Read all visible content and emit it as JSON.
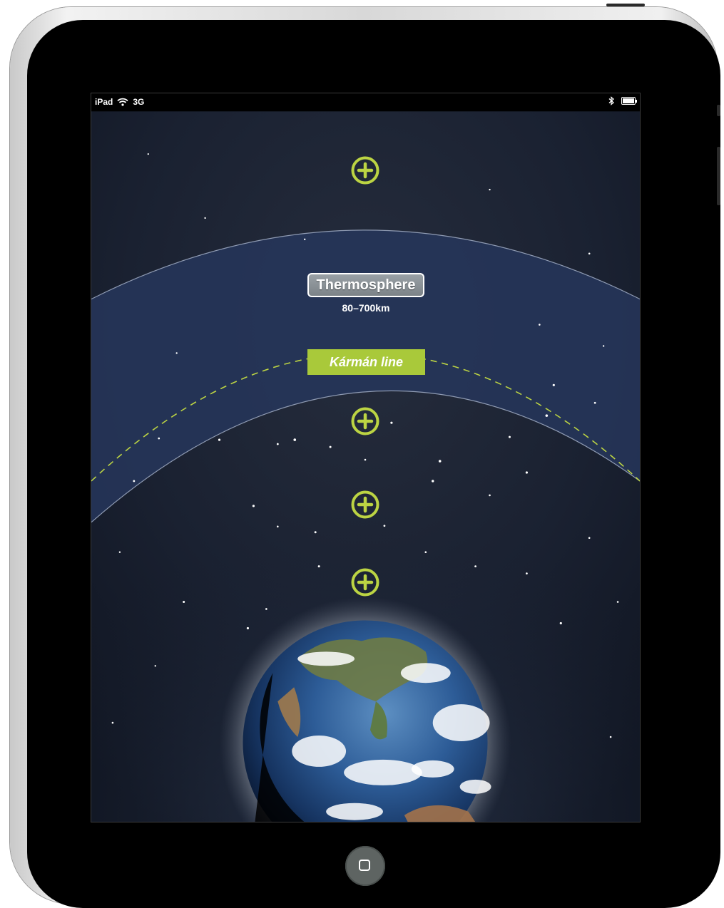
{
  "status_bar": {
    "device": "iPad",
    "network": "3G"
  },
  "layers": {
    "thermosphere": {
      "name": "Thermosphere",
      "range": "80–700km"
    },
    "karman_line": {
      "label": "Kármán line"
    }
  },
  "colors": {
    "accent": "#bcd443",
    "karman_badge": "#a9c93a",
    "thermosphere_band": "#25355a",
    "space": "#141b2b"
  },
  "icons": {
    "expand": "plus-circle-icon",
    "home": "home-square-icon",
    "wifi": "wifi-icon",
    "bluetooth": "bluetooth-icon",
    "battery": "battery-icon"
  }
}
